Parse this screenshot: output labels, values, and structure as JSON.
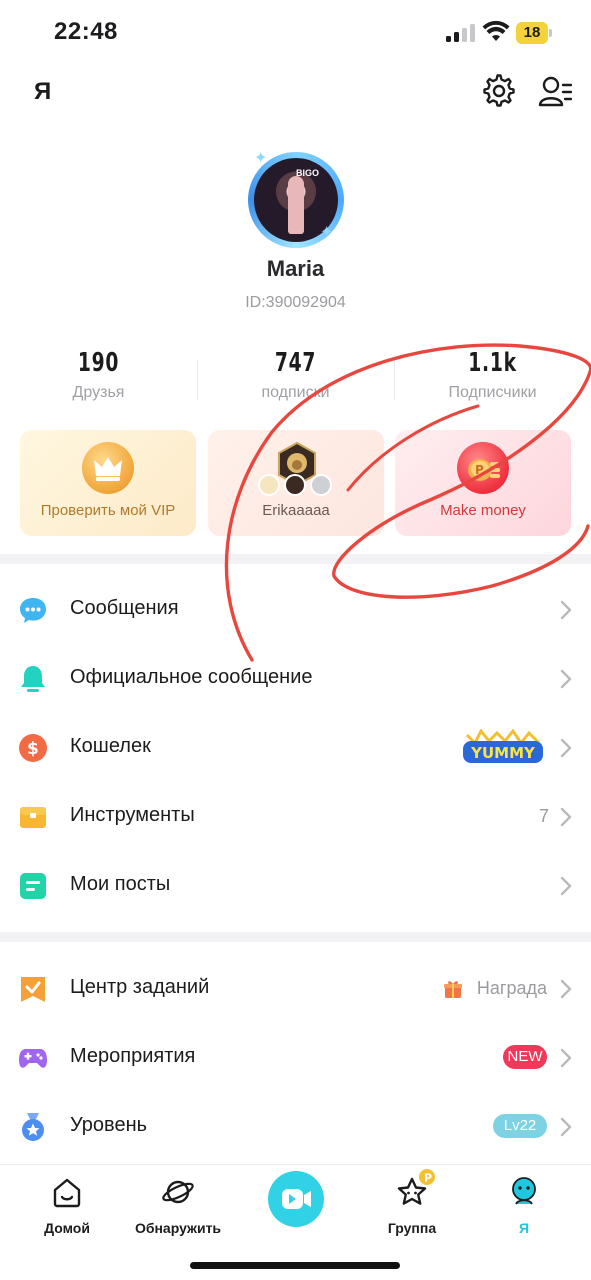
{
  "status_bar": {
    "time": "22:48",
    "battery": "18",
    "battery_color": "#f4d23c"
  },
  "header": {
    "title": "Я",
    "settings_icon": "gear-icon",
    "contacts_icon": "user-list-icon"
  },
  "profile": {
    "name": "Maria",
    "id": "ID:390092904",
    "avatar_text": "BIGO"
  },
  "stats": [
    {
      "value": "190",
      "label": "Друзья"
    },
    {
      "value": "747",
      "label": "подписки"
    },
    {
      "value": "1.1k",
      "label": "Подписчики"
    }
  ],
  "cards": {
    "vip": {
      "label": "Проверить мой VIP",
      "icon": "crown-icon"
    },
    "badge": {
      "label": "Erikaaaaa",
      "icon": "lion-badge-icon"
    },
    "money": {
      "label": "Make money",
      "icon": "coins-icon"
    }
  },
  "menu_section_1": [
    {
      "label": "Сообщения",
      "icon": "chat-bubble-icon",
      "color": "#3fb6f2"
    },
    {
      "label": "Официальное сообщение",
      "icon": "bell-icon",
      "color": "#22d3c2"
    },
    {
      "label": "Кошелек",
      "icon": "dollar-coin-icon",
      "color": "#f26b45",
      "badge": "YUMMY"
    },
    {
      "label": "Инструменты",
      "icon": "toolbox-icon",
      "color": "#f7b731",
      "value": "7"
    },
    {
      "label": "Мои посты",
      "icon": "posts-icon",
      "color": "#22d3a8"
    }
  ],
  "menu_section_2": [
    {
      "label": "Центр заданий",
      "icon": "task-flag-icon",
      "color": "#f6a03a",
      "value": "Награда",
      "value_icon": "gift-icon"
    },
    {
      "label": "Мероприятия",
      "icon": "gamepad-icon",
      "color": "#a066f0",
      "pill": "NEW",
      "pill_color": "#f0395a"
    },
    {
      "label": "Уровень",
      "icon": "medal-icon",
      "color": "#4c8ff0",
      "pill": "Lv22",
      "pill_color": "#7dd3e3"
    }
  ],
  "bottom_nav": [
    {
      "label": "Домой",
      "icon": "home-icon"
    },
    {
      "label": "Обнаружить",
      "icon": "planet-icon"
    },
    {
      "label": "",
      "icon": "live-camera-icon"
    },
    {
      "label": "Группа",
      "icon": "star-icon"
    },
    {
      "label": "Я",
      "icon": "profile-face-icon",
      "active": true
    }
  ],
  "accent_color": "#1ec8df",
  "annotation_color": "#e8473f"
}
